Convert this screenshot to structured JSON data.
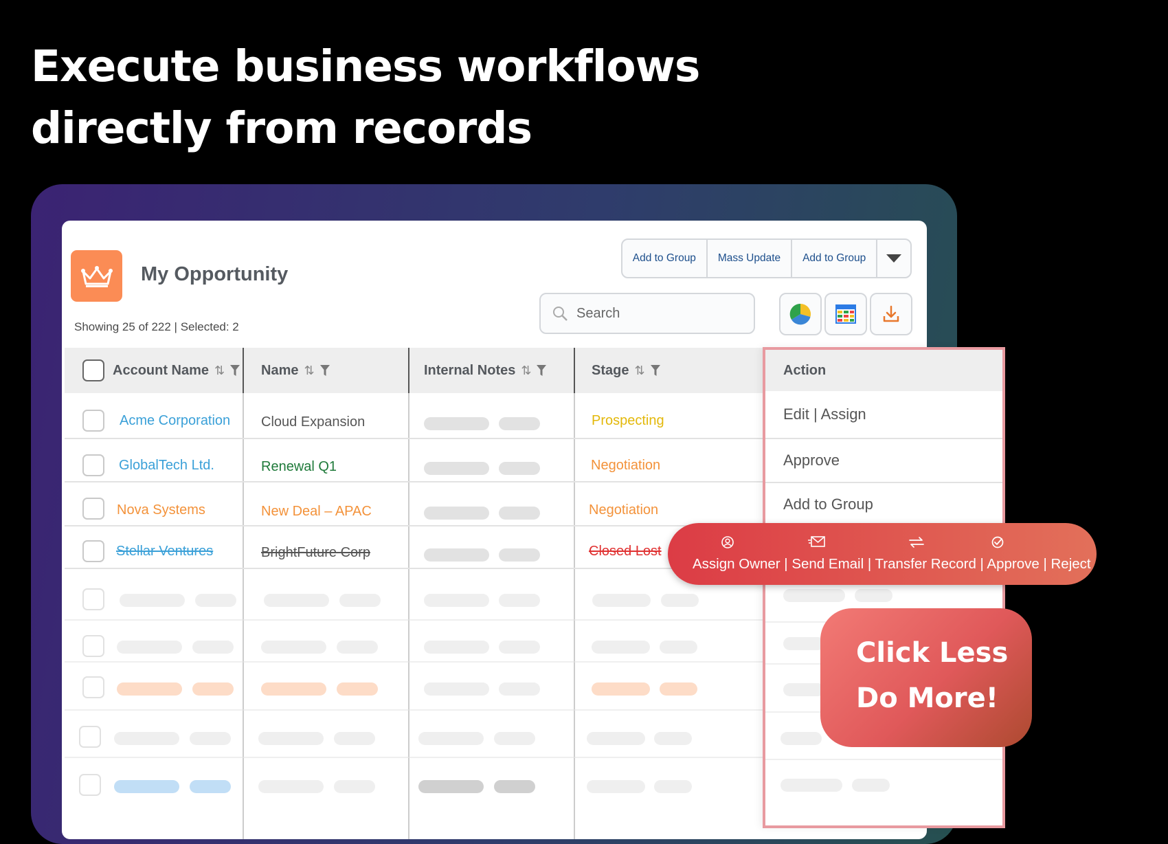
{
  "headline": {
    "line1": "Execute business workflows",
    "line2": "directly from records"
  },
  "app": {
    "title": "My Opportunity",
    "summary": "Showing 25 of 222 | Selected: 2",
    "logo_icon": "crown-icon",
    "brand_color": "#fb8c55"
  },
  "toolbar": {
    "buttons": [
      "Add to Group",
      "Mass Update",
      "Add to Group"
    ],
    "more_icon": "caret-down-icon",
    "search_placeholder": "Search",
    "icons": [
      "pie-chart-icon",
      "table-view-icon",
      "download-icon"
    ]
  },
  "table": {
    "columns": [
      "Account Name",
      "Name",
      "Internal Notes",
      "Stage"
    ],
    "rows": [
      {
        "account": "Acme Corporation",
        "name": "Cloud Expansion",
        "stage": "Prospecting"
      },
      {
        "account": "GlobalTech Ltd.",
        "name": "Renewal Q1",
        "stage": "Negotiation"
      },
      {
        "account": "Nova Systems",
        "name": "New Deal – APAC",
        "stage": "Negotiation"
      },
      {
        "account": "Stellar Ventures",
        "name": "BrightFuture Corp",
        "stage": "Closed Lost"
      }
    ]
  },
  "action_menu": {
    "header": "Action",
    "items": [
      "Edit | Assign",
      "Approve",
      "Add to Group"
    ]
  },
  "ribbon": {
    "text": "Assign Owner | Send Email | Transfer Record | Approve | Reject",
    "icons": [
      "assign-owner-icon",
      "send-email-icon",
      "transfer-record-icon",
      "approve-icon"
    ]
  },
  "promo": {
    "line1": "Click Less",
    "line2": "Do More!"
  }
}
